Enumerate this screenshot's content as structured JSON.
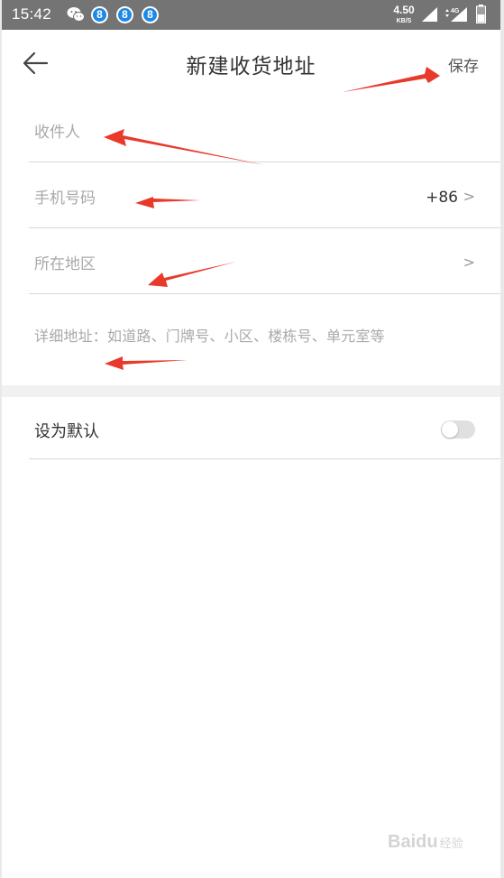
{
  "status_bar": {
    "time": "15:42",
    "app_badge": "8",
    "net_speed": "4.50",
    "net_speed_unit": "KB/S",
    "network_type": "4G"
  },
  "header": {
    "title": "新建收货地址",
    "save_label": "保存"
  },
  "form": {
    "recipient_placeholder": "收件人",
    "phone_placeholder": "手机号码",
    "country_code": "+86",
    "region_placeholder": "所在地区",
    "detail_placeholder": "详细地址：如道路、门牌号、小区、楼栋号、单元室等",
    "chevron": ">"
  },
  "default_setting": {
    "label": "设为默认",
    "enabled": false
  },
  "watermark": {
    "brand": "Baidu",
    "suffix": "经验"
  },
  "colors": {
    "annotation_arrow": "#e8392b",
    "status_bar_bg": "#747474",
    "app_badge": "#1e88e5"
  }
}
